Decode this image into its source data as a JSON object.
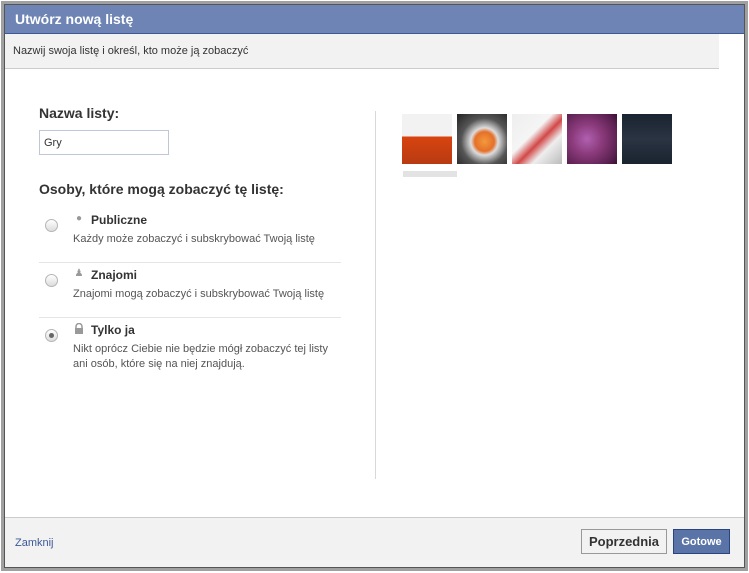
{
  "dialog": {
    "title": "Utwórz nową listę",
    "subtitle": "Nazwij swoja listę i określ, kto może ją zobaczyć"
  },
  "form": {
    "name_label": "Nazwa listy:",
    "name_value": "Gry",
    "who_label": "Osoby, które mogą zobaczyć tę listę:"
  },
  "options": [
    {
      "title": "Publiczne",
      "desc": "Każdy może zobaczyć i subskrybować Twoją listę",
      "icon": "globe-icon",
      "selected": false
    },
    {
      "title": "Znajomi",
      "desc": "Znajomi mogą zobaczyć i subskrybować Twoją listę",
      "icon": "friends-icon",
      "selected": false
    },
    {
      "title": "Tylko ja",
      "desc": "Nikt oprócz Ciebie nie będzie mógł zobaczyć tej listy ani osób, które się na niej znajdują.",
      "icon": "lock-icon",
      "selected": true
    }
  ],
  "footer": {
    "close_label": "Zamknij",
    "prev_label": "Poprzednia",
    "done_label": "Gotowe"
  },
  "colors": {
    "titlebar": "#6d84b4",
    "link": "#3b5998",
    "primary_button": "#5b74a8"
  }
}
